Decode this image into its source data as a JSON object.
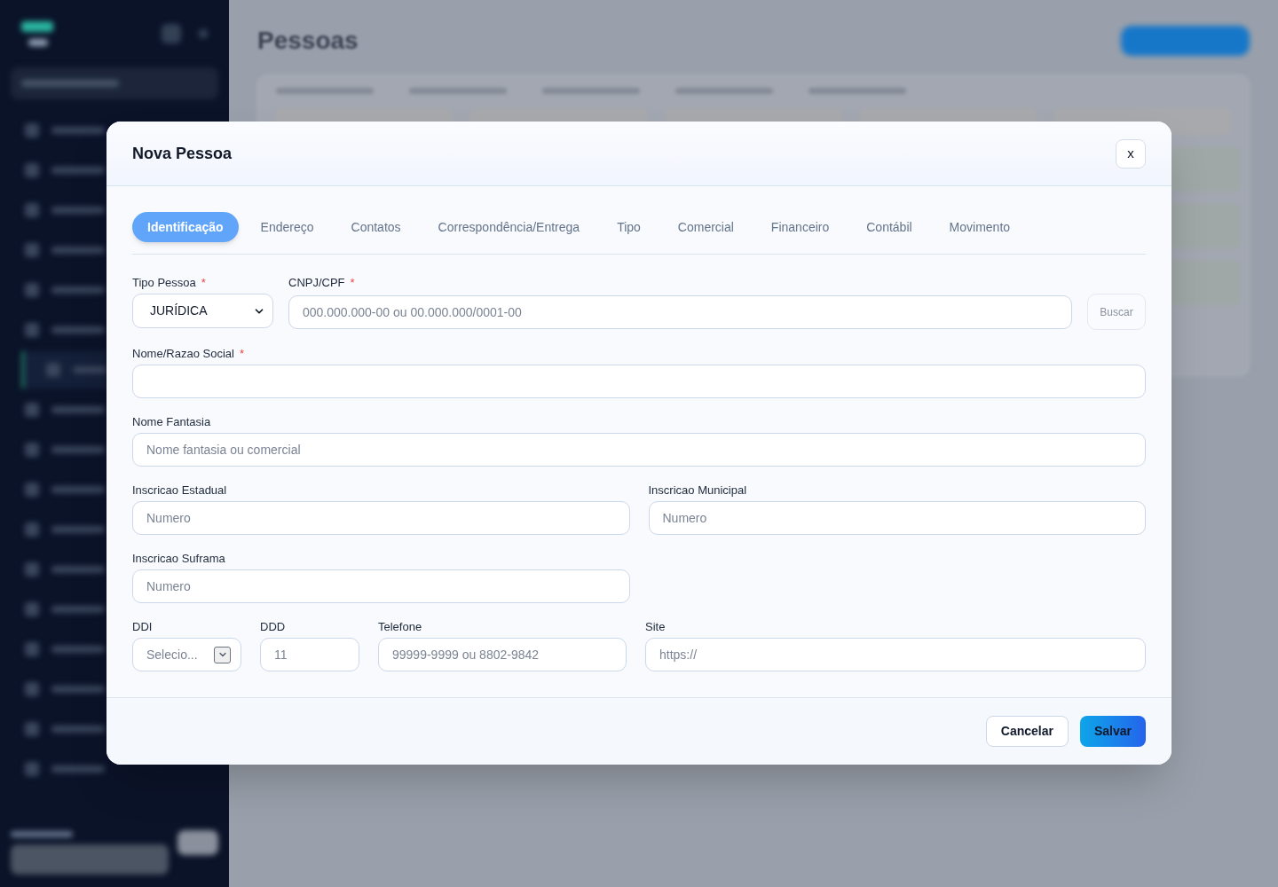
{
  "sidebar": {
    "menu_items": [
      {
        "selected": false
      },
      {
        "selected": false
      },
      {
        "selected": false
      },
      {
        "selected": false
      },
      {
        "selected": false
      },
      {
        "selected": false
      },
      {
        "selected": true
      },
      {
        "selected": false
      },
      {
        "selected": false
      },
      {
        "selected": false
      },
      {
        "selected": false
      },
      {
        "selected": false
      },
      {
        "selected": false
      },
      {
        "selected": false
      },
      {
        "selected": false
      },
      {
        "selected": false
      },
      {
        "selected": false
      }
    ]
  },
  "page": {
    "title": "Pessoas"
  },
  "dialog": {
    "title": "Nova Pessoa",
    "close_button": "x",
    "tabs": [
      {
        "label": "Identificação",
        "selected": true
      },
      {
        "label": "Endereço",
        "selected": false
      },
      {
        "label": "Contatos",
        "selected": false
      },
      {
        "label": "Correspondência/Entrega",
        "selected": false
      },
      {
        "label": "Tipo",
        "selected": false
      },
      {
        "label": "Comercial",
        "selected": false
      },
      {
        "label": "Financeiro",
        "selected": false
      },
      {
        "label": "Contábil",
        "selected": false
      },
      {
        "label": "Movimento",
        "selected": false
      }
    ],
    "rows": [
      {
        "fields": [
          {
            "kind": "select",
            "label": "Tipo Pessoa",
            "required_mark": "*",
            "value": "JURÍDICA"
          },
          {
            "kind": "text",
            "label": "CNPJ/CPF",
            "required_mark": "*",
            "placeholder": "000.000.000-00 ou 00.000.000/0001-00",
            "action_button": "Buscar"
          }
        ]
      },
      {
        "fields": [
          {
            "kind": "text",
            "label": "Nome/Razao Social",
            "required_mark": "*"
          }
        ]
      },
      {
        "fields": [
          {
            "kind": "text",
            "label": "Nome Fantasia",
            "placeholder": "Nome fantasia ou comercial"
          }
        ]
      },
      {
        "fields": [
          {
            "kind": "text",
            "label": "Inscricao Estadual",
            "placeholder": "Numero"
          },
          {
            "kind": "text",
            "label": "Inscricao Municipal",
            "placeholder": "Numero"
          }
        ]
      },
      {
        "fields": [
          {
            "kind": "text",
            "label": "Inscricao Suframa",
            "placeholder": "Numero"
          }
        ]
      },
      {
        "fields": [
          {
            "kind": "dropdown",
            "label": "DDI",
            "placeholder": "Selecio..."
          },
          {
            "kind": "text",
            "label": "DDD",
            "placeholder": "11"
          },
          {
            "kind": "text",
            "label": "Telefone",
            "placeholder": "99999-9999 ou 8802-9842"
          },
          {
            "kind": "text",
            "label": "Site",
            "placeholder": "https://"
          }
        ]
      }
    ],
    "buttons": [
      {
        "label": "Cancelar",
        "kind": "secondary"
      },
      {
        "label": "Salvar",
        "kind": "primary"
      }
    ]
  }
}
